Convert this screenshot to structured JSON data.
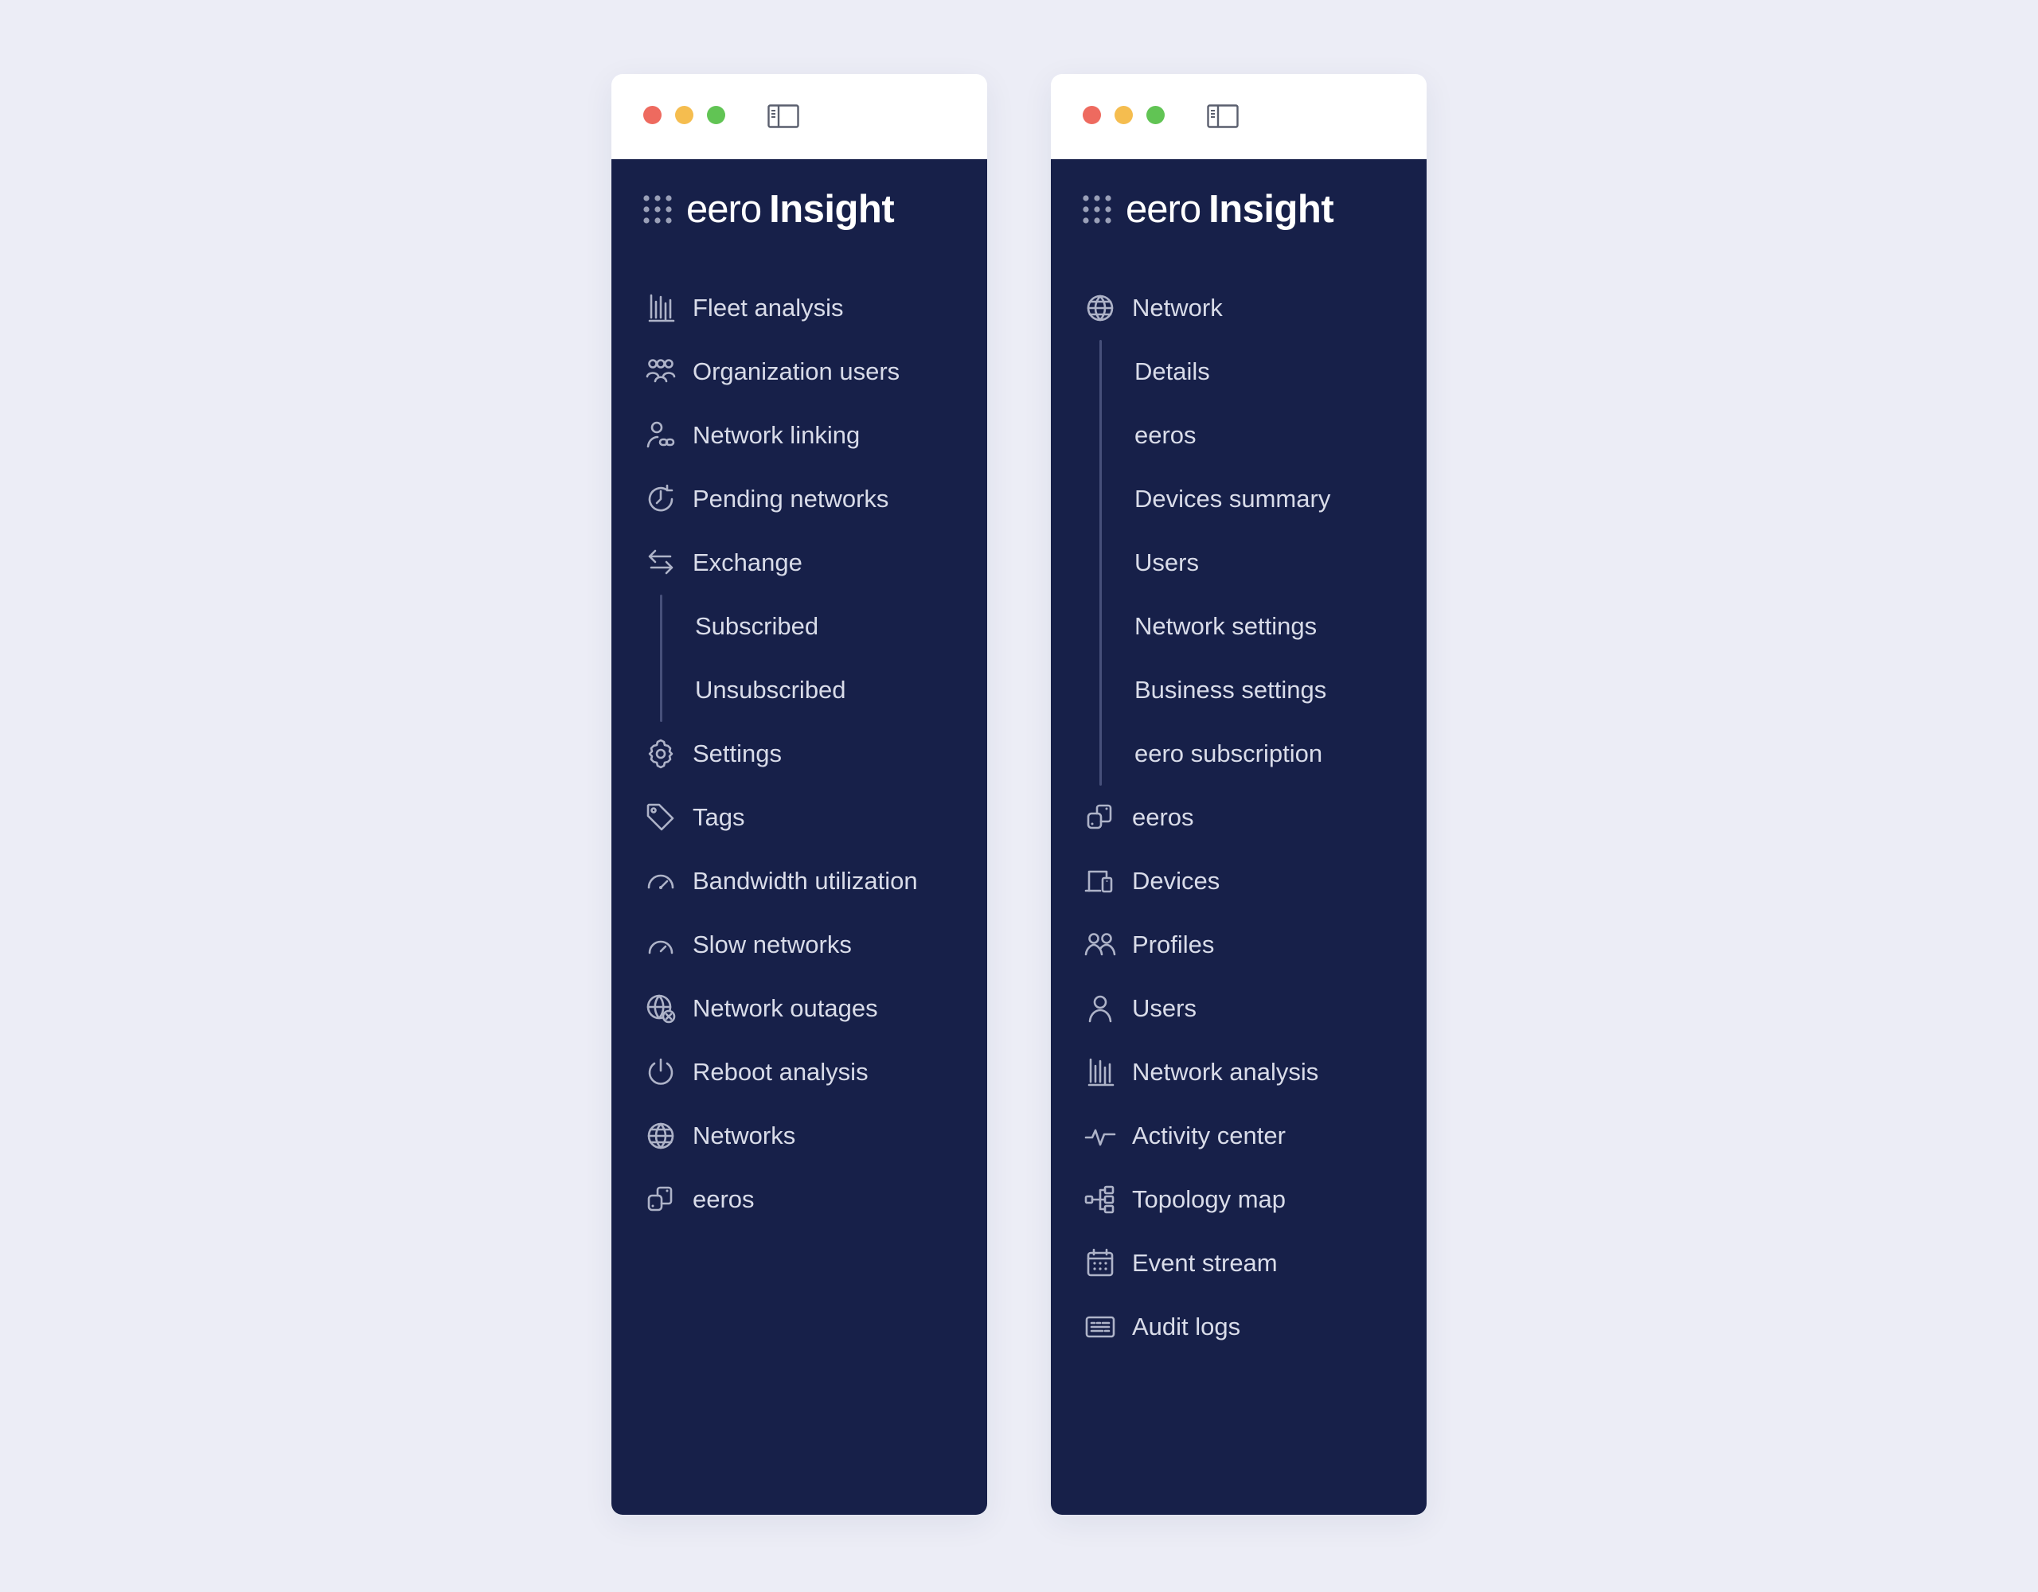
{
  "windows": [
    {
      "brand": {
        "eero": "eero",
        "insight": "Insight"
      },
      "items": [
        {
          "label": "Fleet analysis",
          "icon": "bar-chart-icon"
        },
        {
          "label": "Organization users",
          "icon": "users-group-icon"
        },
        {
          "label": "Network linking",
          "icon": "user-link-icon"
        },
        {
          "label": "Pending networks",
          "icon": "clock-pending-icon"
        },
        {
          "label": "Exchange",
          "icon": "exchange-arrows-icon",
          "children": [
            {
              "label": "Subscribed"
            },
            {
              "label": "Unsubscribed"
            }
          ]
        },
        {
          "label": "Settings",
          "icon": "gear-icon"
        },
        {
          "label": "Tags",
          "icon": "tag-icon"
        },
        {
          "label": "Bandwidth utilization",
          "icon": "gauge-icon"
        },
        {
          "label": "Slow networks",
          "icon": "slow-gauge-icon"
        },
        {
          "label": "Network outages",
          "icon": "globe-x-icon"
        },
        {
          "label": "Reboot analysis",
          "icon": "power-icon"
        },
        {
          "label": "Networks",
          "icon": "globe-icon"
        },
        {
          "label": "eeros",
          "icon": "eero-device-icon"
        }
      ]
    },
    {
      "brand": {
        "eero": "eero",
        "insight": "Insight"
      },
      "items": [
        {
          "label": "Network",
          "icon": "globe-icon",
          "children": [
            {
              "label": "Details"
            },
            {
              "label": "eeros"
            },
            {
              "label": "Devices summary"
            },
            {
              "label": "Users"
            },
            {
              "label": "Network settings"
            },
            {
              "label": "Business settings"
            },
            {
              "label": "eero subscription"
            }
          ]
        },
        {
          "label": "eeros",
          "icon": "eero-device-icon"
        },
        {
          "label": "Devices",
          "icon": "devices-icon"
        },
        {
          "label": "Profiles",
          "icon": "profiles-icon"
        },
        {
          "label": "Users",
          "icon": "user-icon"
        },
        {
          "label": "Network analysis",
          "icon": "bar-chart-icon"
        },
        {
          "label": "Activity center",
          "icon": "activity-icon"
        },
        {
          "label": "Topology map",
          "icon": "topology-icon"
        },
        {
          "label": "Event stream",
          "icon": "calendar-icon"
        },
        {
          "label": "Audit logs",
          "icon": "keyboard-log-icon"
        }
      ]
    }
  ],
  "colors": {
    "background": "#ecedf6",
    "sidebar": "#172049",
    "text": "#d9dce9",
    "icon": "#aeb3c8",
    "traffic_red": "#ee6a5f",
    "traffic_yellow": "#f5bd4f",
    "traffic_green": "#61c454"
  }
}
